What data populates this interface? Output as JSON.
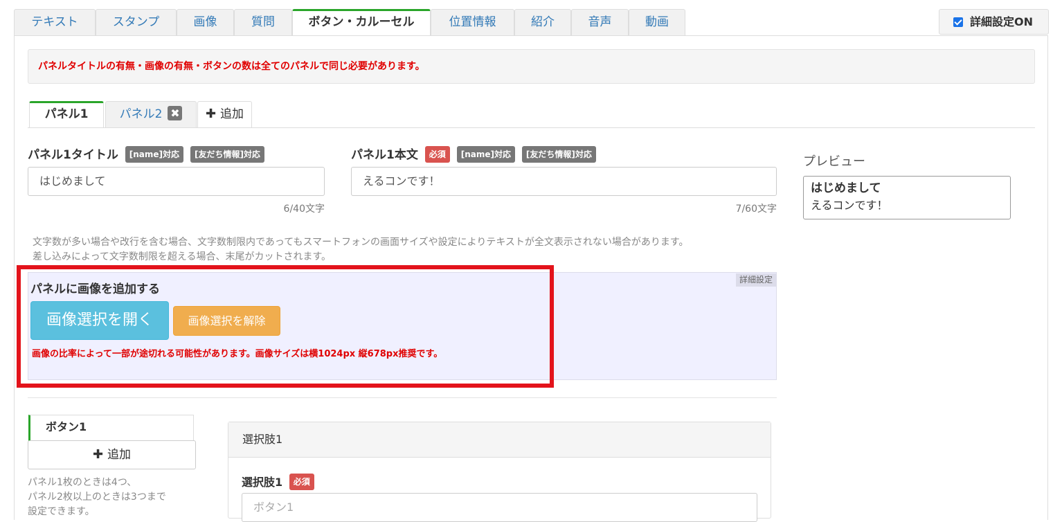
{
  "top_tabs": [
    "テキスト",
    "スタンプ",
    "画像",
    "質問",
    "ボタン・カルーセル",
    "位置情報",
    "紹介",
    "音声",
    "動画"
  ],
  "detail_toggle_label": "詳細設定ON",
  "alert_message": "パネルタイトルの有無・画像の有無・ボタンの数は全てのパネルで同じ必要があります。",
  "panel_tabs": {
    "panel1": "パネル1",
    "panel2": "パネル2",
    "remove_icon": "✖",
    "add": "追加"
  },
  "title_field": {
    "label": "パネル1タイトル",
    "badge_name": "[name]対応",
    "badge_friend": "[友だち情報]対応",
    "value": "はじめまして",
    "count": "6/40文字"
  },
  "body_field": {
    "label": "パネル1本文",
    "badge_required": "必須",
    "badge_name": "[name]対応",
    "badge_friend": "[友だち情報]対応",
    "value": "えるコンです！",
    "count": "7/60文字"
  },
  "notes": {
    "line1": "文字数が多い場合や改行を含む場合、文字数制限内であってもスマートフォンの画面サイズや設定によりテキストが全文表示されない場合があります。",
    "line2": "差し込みによって文字数制限を超える場合、末尾がカットされます。"
  },
  "image_section": {
    "tag": "詳細設定",
    "title": "パネルに画像を追加する",
    "open_button": "画像選択を開く",
    "clear_button": "画像選択を解除",
    "warning": "画像の比率によって一部が途切れる可能性があります。画像サイズは横1024px 縦678px推奨です。"
  },
  "buttons_section": {
    "tab": "ボタン1",
    "add": "追加",
    "note1": "パネル1枚のときは4つ、",
    "note2": "パネル2枚以上のときは3つまで",
    "note3": "設定できます。"
  },
  "choice": {
    "header": "選択肢1",
    "label": "選択肢1",
    "badge_required": "必須",
    "placeholder": "ボタン1"
  },
  "preview": {
    "label": "プレビュー",
    "title": "はじめまして",
    "body": "えるコンです！"
  },
  "colors": {
    "accent_green": "#2aa52a",
    "alert_red": "#e00000",
    "highlight_frame": "#e3131b",
    "primary_button": "#5bc0de",
    "warning_button": "#f0ad4e"
  }
}
